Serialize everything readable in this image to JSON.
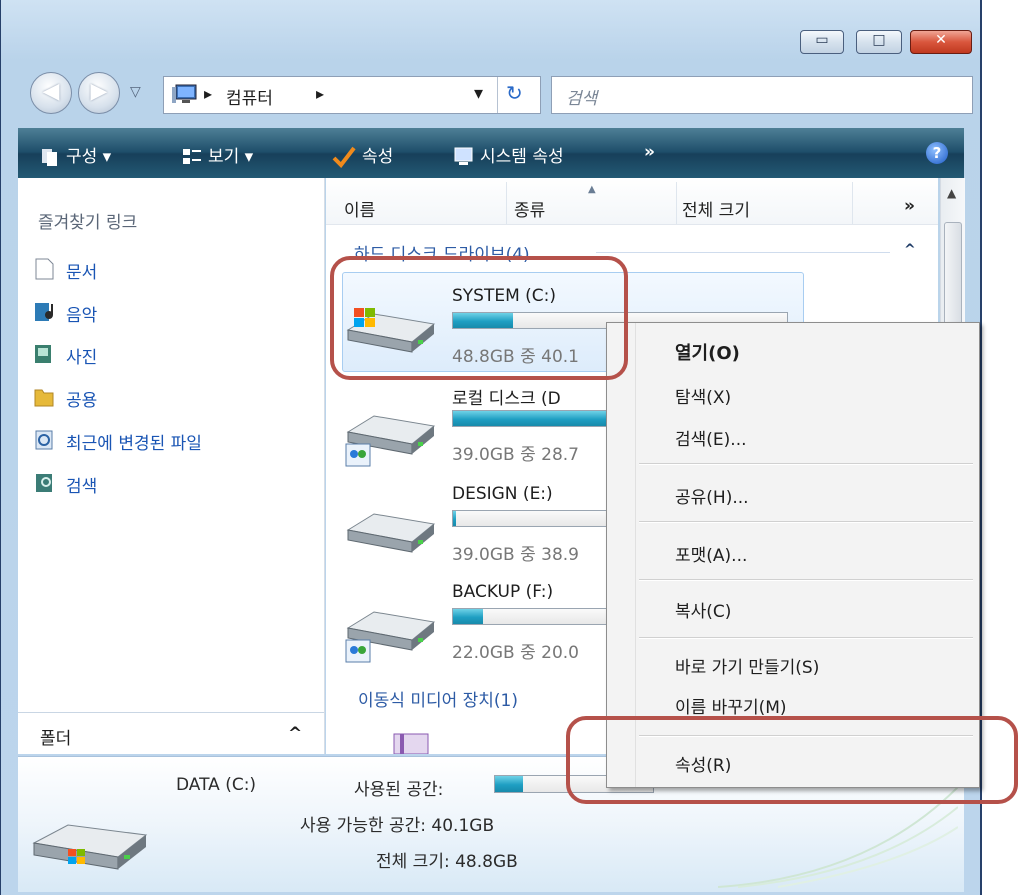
{
  "window": {
    "min_glyph": "▭",
    "max_glyph": "□",
    "close_glyph": "✕"
  },
  "address": {
    "crumb_sep": "▸",
    "path": "컴퓨터",
    "dropdown": "▾",
    "refresh": "↻",
    "search_placeholder": "검색"
  },
  "toolbar": {
    "organize": "구성 ▾",
    "views": "보기 ▾",
    "properties": "속성",
    "system_properties": "시스템 속성",
    "more": "»",
    "help": "?"
  },
  "nav": {
    "favorites_title": "즐겨찾기 링크",
    "links": [
      {
        "label": "문서",
        "icon": "document-icon"
      },
      {
        "label": "음악",
        "icon": "music-icon"
      },
      {
        "label": "사진",
        "icon": "pictures-icon"
      },
      {
        "label": "공용",
        "icon": "public-folder-icon"
      },
      {
        "label": "최근에 변경된 파일",
        "icon": "recent-files-icon"
      },
      {
        "label": "검색",
        "icon": "search-folder-icon"
      }
    ],
    "folders_label": "폴더",
    "folders_chevron": "^"
  },
  "columns": {
    "name": "이름",
    "type": "종류",
    "total_size": "전체 크기",
    "more": "»"
  },
  "groups": {
    "hard_disks": "하드 디스크 드라이브(4)",
    "removable": "이동식 미디어 장치(1)"
  },
  "drives": [
    {
      "name": "SYSTEM (C:)",
      "size_text": "48.8GB 중 40.1",
      "used_fraction": 0.18
    },
    {
      "name": "로컬 디스크 (D",
      "size_text": "39.0GB 중 28.7",
      "used_fraction": 0.57
    },
    {
      "name": "DESIGN (E:)",
      "size_text": "39.0GB 중 38.9",
      "used_fraction": 0.01
    },
    {
      "name": "BACKUP (F:)",
      "size_text": "22.0GB 중 20.0",
      "used_fraction": 0.09
    }
  ],
  "context_menu": {
    "items": [
      {
        "label": "열기(O)",
        "default": true
      },
      {
        "label": "탐색(X)"
      },
      {
        "label": "검색(E)..."
      },
      {
        "label": "공유(H)..."
      },
      {
        "label": "포맷(A)..."
      },
      {
        "label": "복사(C)"
      },
      {
        "label": "바로 가기 만들기(S)"
      },
      {
        "label": "이름 바꾸기(M)"
      },
      {
        "label": "속성(R)"
      }
    ]
  },
  "details": {
    "drive_name": "DATA (C:)",
    "used_label": "사용된 공간:",
    "used_fraction": 0.18,
    "free_label": "사용 가능한 공간: 40.1GB",
    "total_label": "전체 크기: 48.8GB"
  },
  "colors": {
    "accent_link": "#1a55b4",
    "toolbar": "#1e4e6a",
    "highlight_box": "#b5514a",
    "progress": "#1f9fc3"
  }
}
